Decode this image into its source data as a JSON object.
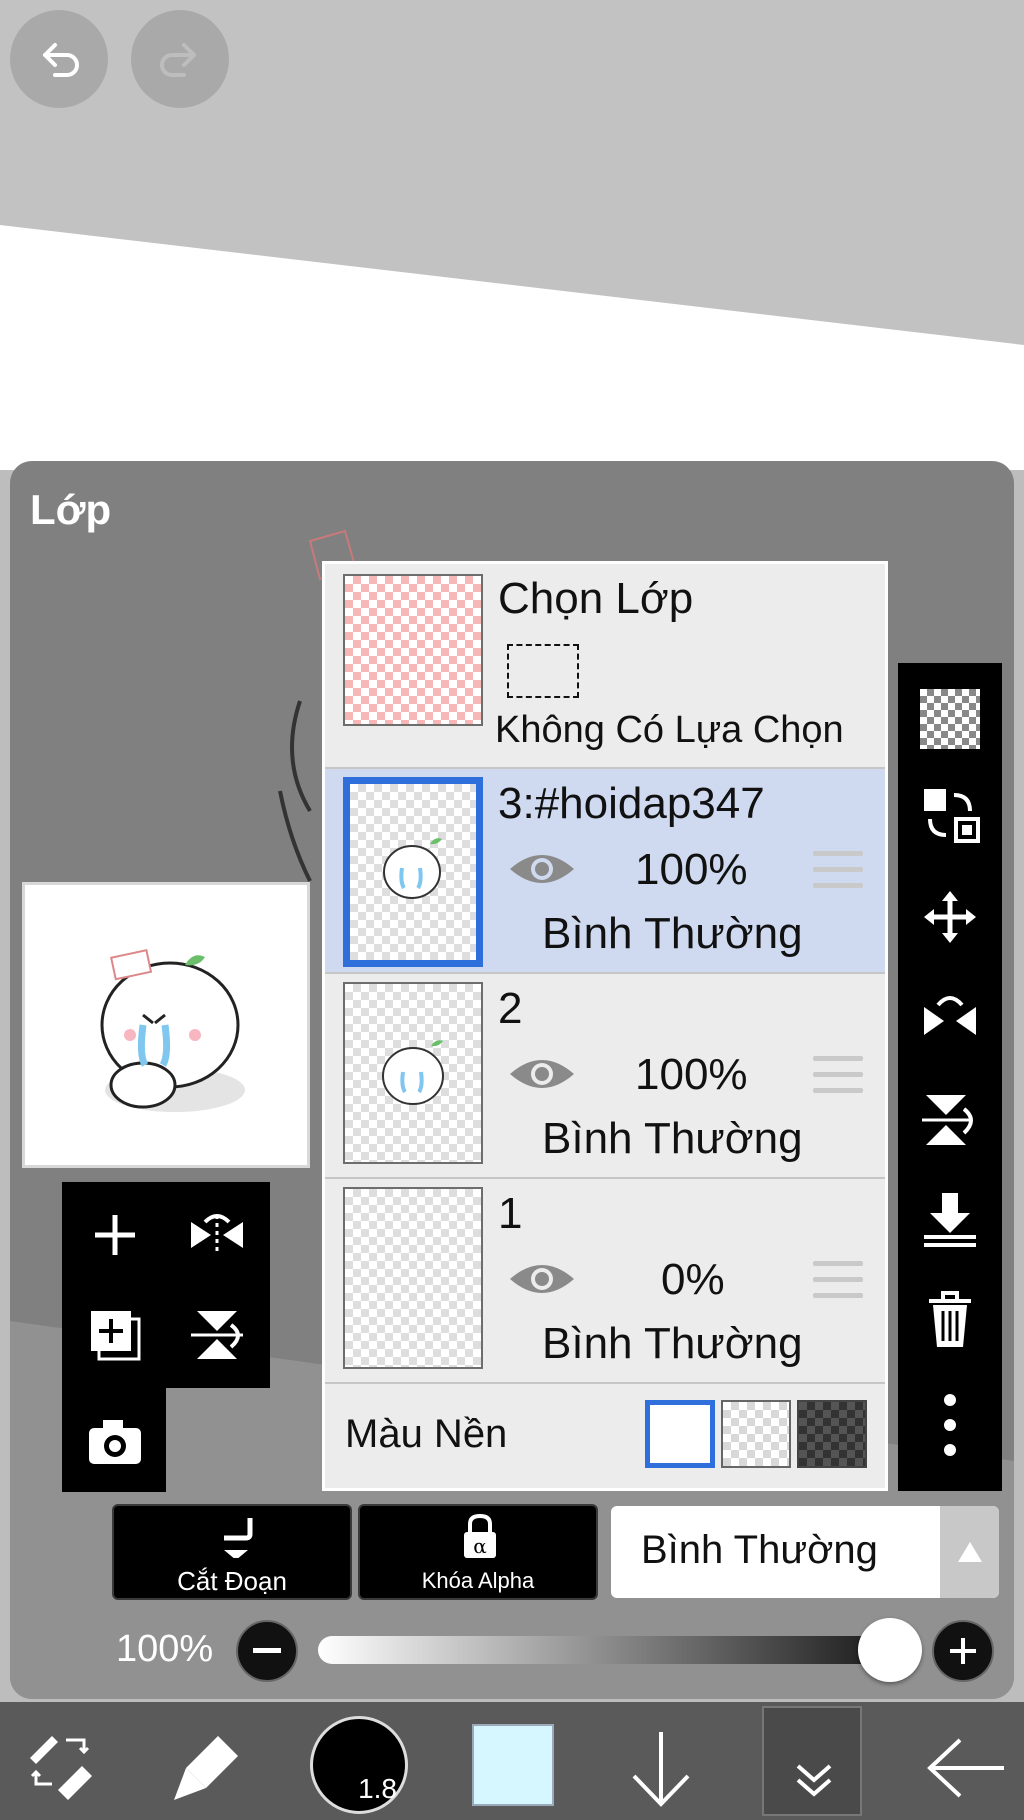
{
  "panel": {
    "title": "Lớp"
  },
  "selection_layer": {
    "title": "Chọn Lớp",
    "subtitle": "Không Có Lựa Chọn"
  },
  "layers": [
    {
      "name": "3:#hoidap347",
      "opacity": "100%",
      "mode": "Bình Thường",
      "selected": true
    },
    {
      "name": "2",
      "opacity": "100%",
      "mode": "Bình Thường",
      "selected": false
    },
    {
      "name": "1",
      "opacity": "0%",
      "mode": "Bình Thường",
      "selected": false
    }
  ],
  "background": {
    "label": "Màu Nền"
  },
  "actions": {
    "clipping": "Cắt Đoạn",
    "alpha_lock": "Khóa Alpha"
  },
  "blend_mode": {
    "value": "Bình Thường"
  },
  "opacity_slider": {
    "label": "100%",
    "value": 1.0
  },
  "toolbar": {
    "brush_size": "1.8",
    "color": "#d6f7ff"
  },
  "colors": {
    "accent": "#2f6fdc",
    "selected_row": "#cfdaf0"
  }
}
